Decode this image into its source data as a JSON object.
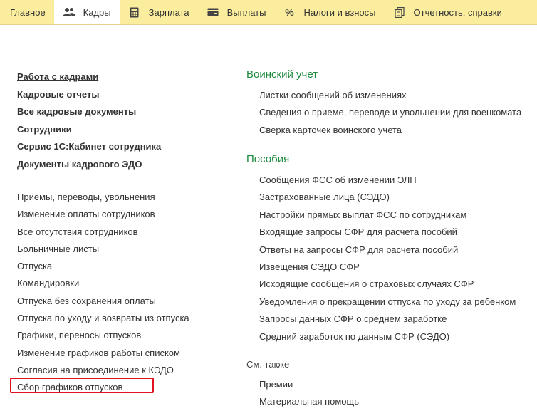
{
  "topbar": {
    "tabs": [
      {
        "label": "Главное",
        "icon": "none"
      },
      {
        "label": "Кадры",
        "icon": "people-icon"
      },
      {
        "label": "Зарплата",
        "icon": "calculator-icon"
      },
      {
        "label": "Выплаты",
        "icon": "wallet-icon"
      },
      {
        "label": "Налоги и взносы",
        "icon": "percent-icon"
      },
      {
        "label": "Отчетность, справки",
        "icon": "documents-icon"
      }
    ],
    "active_tab": "Кадры",
    "accent_color": "#fbed9e"
  },
  "left": {
    "bold_links": [
      "Работа с кадрами",
      "Кадровые отчеты",
      "Все кадровые документы",
      "Сотрудники",
      "Сервис 1С:Кабинет сотрудника",
      "Документы кадрового ЭДО"
    ],
    "links": [
      "Приемы, переводы, увольнения",
      "Изменение оплаты сотрудников",
      "Все отсутствия сотрудников",
      "Больничные листы",
      "Отпуска",
      "Командировки",
      "Отпуска без сохранения оплаты",
      "Отпуска по уходу и возвраты из отпуска",
      "Графики, переносы отпусков",
      "Изменение графиков работы списком",
      "Согласия на присоединение к КЭДО",
      "Сбор графиков отпусков"
    ]
  },
  "right": {
    "military": {
      "title": "Воинский учет",
      "links": [
        "Листки сообщений об изменениях",
        "Сведения о приеме, переводе и увольнении для военкомата",
        "Сверка карточек воинского учета"
      ]
    },
    "benefits": {
      "title": "Пособия",
      "links": [
        "Сообщения ФСС об изменении ЭЛН",
        "Застрахованные лица (СЭДО)",
        "Настройки прямых выплат ФСС по сотрудникам",
        "Входящие запросы СФР для расчета пособий",
        "Ответы на запросы СФР для расчета пособий",
        "Извещения СЭДО СФР",
        "Исходящие сообщения о страховых случаях СФР",
        "Уведомления о прекращении отпуска по уходу за ребенком",
        "Запросы данных СФР о среднем заработке",
        "Средний заработок по данным СФР (СЭДО)"
      ]
    },
    "see_also": {
      "title": "См. также",
      "links": [
        "Премии",
        "Материальная помощь"
      ]
    }
  },
  "colors": {
    "section_title": "#1e8a3e",
    "highlight_border": "#e0141e"
  }
}
